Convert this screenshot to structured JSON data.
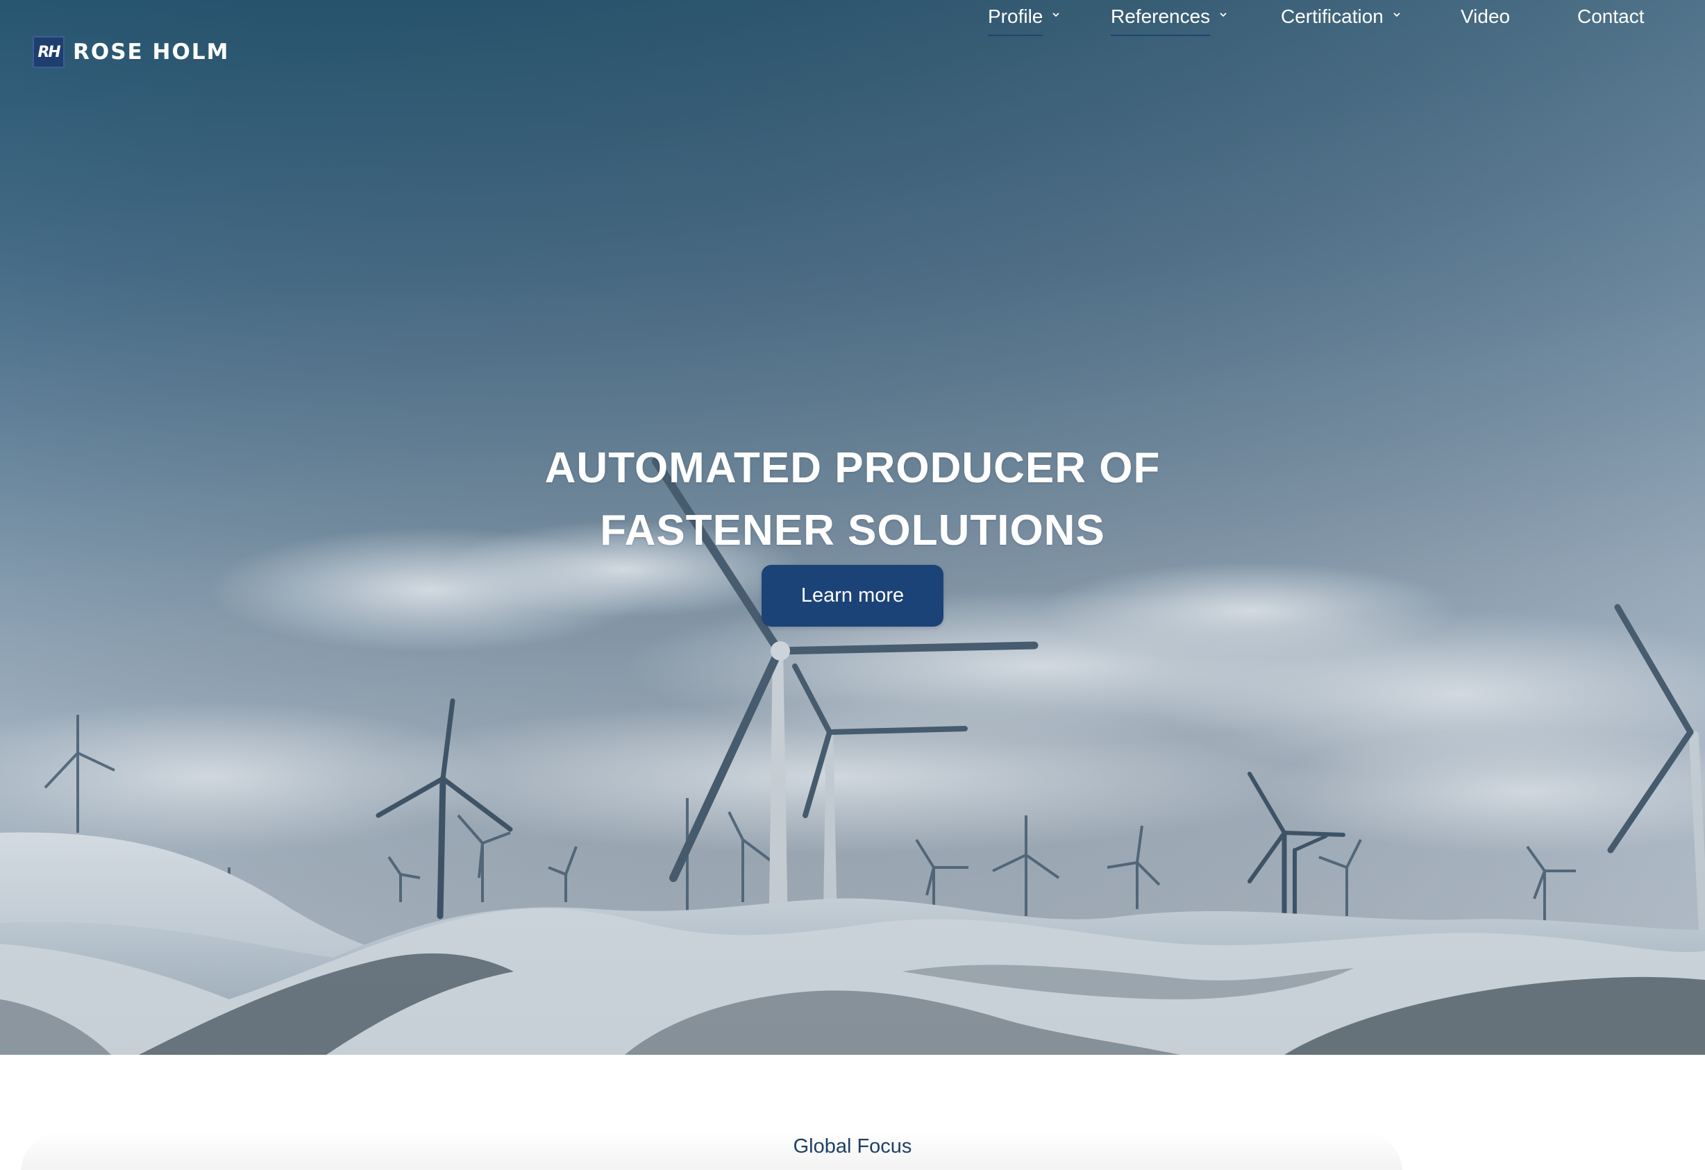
{
  "brand": {
    "logo_mark": "RH",
    "name": "ROSE HOLM"
  },
  "nav": {
    "items": [
      {
        "label": "Profile",
        "has_dropdown": true,
        "active": true
      },
      {
        "label": "References",
        "has_dropdown": true,
        "active": true
      },
      {
        "label": "Certification",
        "has_dropdown": true,
        "active": false
      },
      {
        "label": "Video",
        "has_dropdown": false,
        "active": false
      },
      {
        "label": "Contact",
        "has_dropdown": false,
        "active": false
      }
    ]
  },
  "hero": {
    "title_line1": "AUTOMATED PRODUCER OF",
    "title_line2": "FASTENER SOLUTIONS",
    "cta_label": "Learn more",
    "background_icon": "wind-turbines-snowy-hills-photo"
  },
  "section": {
    "label": "Global Focus"
  },
  "colors": {
    "brand_blue": "#1b4377",
    "logo_mark_bg": "#1d3e6e",
    "section_label": "#1f3f66",
    "nav_text": "#ffffff"
  }
}
